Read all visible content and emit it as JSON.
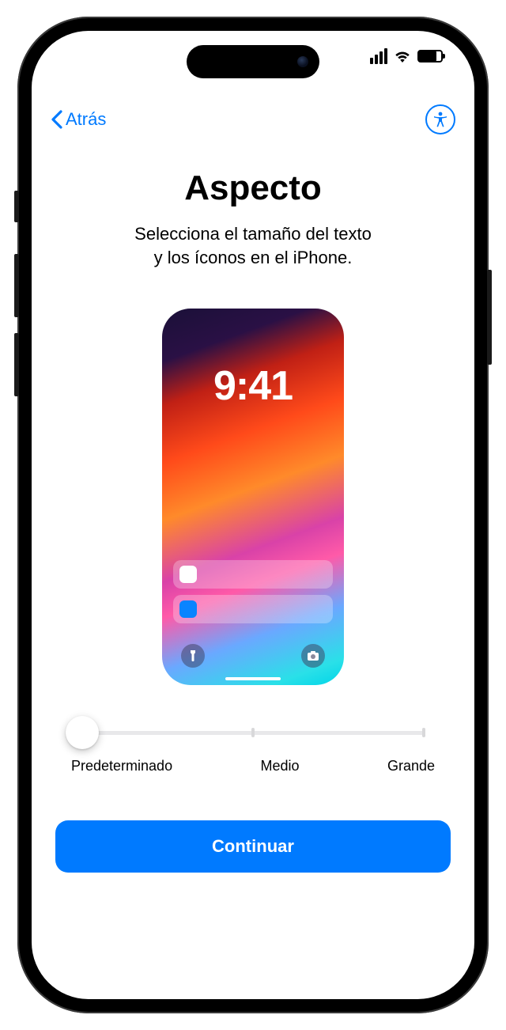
{
  "nav": {
    "back_label": "Atrás"
  },
  "title": "Aspecto",
  "subtitle_line1": "Selecciona el tamaño del texto",
  "subtitle_line2": "y los íconos en el iPhone.",
  "preview": {
    "time": "9:41"
  },
  "slider": {
    "options": [
      "Predeterminado",
      "Medio",
      "Grande"
    ],
    "selected_index": 0
  },
  "continue_label": "Continuar",
  "colors": {
    "accent": "#007AFF"
  }
}
